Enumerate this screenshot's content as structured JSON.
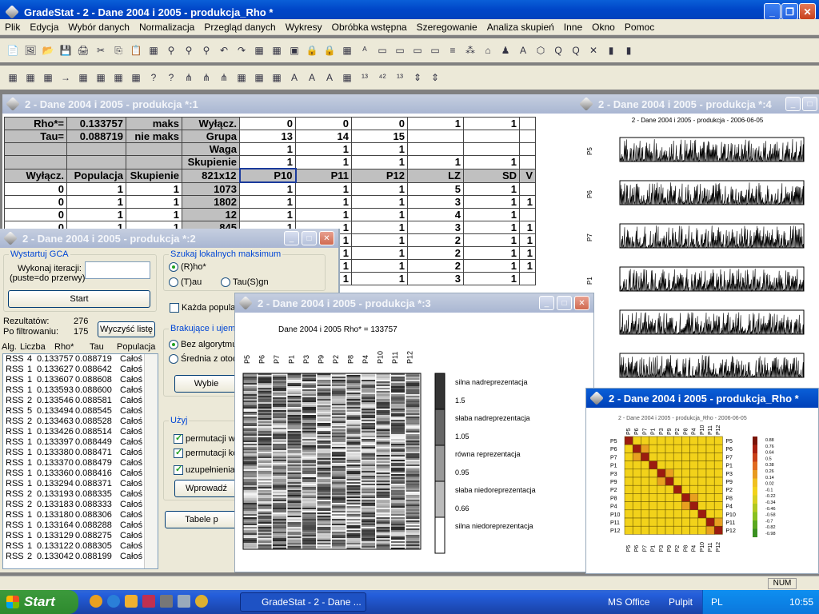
{
  "app": {
    "title": "GradeStat - 2 - Dane 2004 i 2005 - produkcja_Rho *"
  },
  "menu": [
    "Plik",
    "Edycja",
    "Wybór danych",
    "Normalizacja",
    "Przegląd danych",
    "Wykresy",
    "Obróbka wstępna",
    "Szeregowanie",
    "Analiza skupień",
    "Inne",
    "Okno",
    "Pomoc"
  ],
  "win1": {
    "title": "2 - Dane 2004 i 2005 - produkcja *:1",
    "header_rows": [
      [
        "Rho*=",
        "0.133757",
        "maks",
        "Wyłącz.",
        "0",
        "0",
        "0",
        "1",
        "1",
        ""
      ],
      [
        "Tau=",
        "0.088719",
        "nie maks",
        "Grupa",
        "13",
        "14",
        "15",
        "",
        "",
        ""
      ],
      [
        "",
        "",
        "",
        "Waga",
        "1",
        "1",
        "1",
        "",
        "",
        ""
      ],
      [
        "",
        "",
        "",
        "Skupienie",
        "1",
        "1",
        "1",
        "1",
        "1",
        ""
      ],
      [
        "Wyłącz.",
        "Populacja",
        "Skupienie",
        "821x12",
        "P10",
        "P11",
        "P12",
        "LZ",
        "SD",
        "V"
      ],
      [
        "0",
        "1",
        "1",
        "1073",
        "1",
        "1",
        "1",
        "5",
        "1",
        ""
      ],
      [
        "0",
        "1",
        "1",
        "1802",
        "1",
        "1",
        "1",
        "3",
        "1",
        "1"
      ],
      [
        "0",
        "1",
        "1",
        "12",
        "1",
        "1",
        "1",
        "4",
        "1",
        ""
      ],
      [
        "0",
        "1",
        "1",
        "845",
        "1",
        "1",
        "1",
        "3",
        "1",
        "1"
      ]
    ],
    "extra_rows": [
      [
        "1",
        "1",
        "1",
        "2",
        "1",
        "1"
      ],
      [
        "1",
        "1",
        "1",
        "2",
        "1",
        "1"
      ],
      [
        "1",
        "1",
        "1",
        "2",
        "1",
        "1"
      ],
      [
        "1",
        "1",
        "1",
        "3",
        "1",
        ""
      ]
    ]
  },
  "win2": {
    "title": "2 - Dane 2004 i 2005 - produkcja *:2",
    "gca_group": "Wystartuj GCA",
    "iter_label": "Wykonaj iteracji:",
    "iter_hint": "(puste=do przerwy)",
    "start_btn": "Start",
    "local_group": "Szukaj lokalnych maksimum",
    "opt_rho": "(R)ho*",
    "opt_tau": "(T)au",
    "opt_taus": "Tau(S)gn",
    "each_pop": "Każda popula",
    "results_label": "Rezultatów:",
    "results_value": "276",
    "filtered_label": "Po filtrowaniu:",
    "filtered_value": "175",
    "clear_btn": "Wyczyść listę",
    "missing_group": "Brakujące i ujem",
    "opt_noalg": "Bez algorytmu",
    "opt_avg": "Średnia z otoc",
    "select_btn": "Wybie",
    "use_group": "Użyj",
    "use1": "permutacji w",
    "use2": "permutacji ko",
    "use3": "uzupełnienia",
    "enter_btn": "Wprowadź",
    "tables_btn": "Tabele p",
    "list_headers": [
      "Alg.",
      "Liczba",
      "Rho*",
      "Tau",
      "Populacja"
    ],
    "list_rows": [
      [
        "RSS",
        "4",
        "0.133757",
        "0.088719",
        "Całoś"
      ],
      [
        "RSS",
        "1",
        "0.133627",
        "0.088642",
        "Całoś"
      ],
      [
        "RSS",
        "1",
        "0.133607",
        "0.088608",
        "Całoś"
      ],
      [
        "RSS",
        "1",
        "0.133593",
        "0.088600",
        "Całoś"
      ],
      [
        "RSS",
        "2",
        "0.133546",
        "0.088581",
        "Całoś"
      ],
      [
        "RSS",
        "5",
        "0.133494",
        "0.088545",
        "Całoś"
      ],
      [
        "RSS",
        "2",
        "0.133463",
        "0.088528",
        "Całoś"
      ],
      [
        "RSS",
        "1",
        "0.133426",
        "0.088514",
        "Całoś"
      ],
      [
        "RSS",
        "1",
        "0.133397",
        "0.088449",
        "Całoś"
      ],
      [
        "RSS",
        "1",
        "0.133380",
        "0.088471",
        "Całoś"
      ],
      [
        "RSS",
        "1",
        "0.133370",
        "0.088479",
        "Całoś"
      ],
      [
        "RSS",
        "1",
        "0.133360",
        "0.088416",
        "Całoś"
      ],
      [
        "RSS",
        "1",
        "0.133294",
        "0.088371",
        "Całoś"
      ],
      [
        "RSS",
        "2",
        "0.133193",
        "0.088335",
        "Całoś"
      ],
      [
        "RSS",
        "2",
        "0.133183",
        "0.088333",
        "Całoś"
      ],
      [
        "RSS",
        "1",
        "0.133180",
        "0.088306",
        "Całoś"
      ],
      [
        "RSS",
        "1",
        "0.133164",
        "0.088288",
        "Całoś"
      ],
      [
        "RSS",
        "1",
        "0.133129",
        "0.088275",
        "Całoś"
      ],
      [
        "RSS",
        "1",
        "0.133122",
        "0.088305",
        "Całoś"
      ],
      [
        "RSS",
        "2",
        "0.133042",
        "0.088199",
        "Całoś"
      ]
    ]
  },
  "win3": {
    "title": "2 - Dane 2004 i 2005 - produkcja *:3",
    "caption": "Dane 2004 i 2005 Rho* = 133757",
    "columns": [
      "P5",
      "P6",
      "P7",
      "P1",
      "P3",
      "P9",
      "P2",
      "P8",
      "P4",
      "P10",
      "P11",
      "P12"
    ],
    "legend": [
      "silna nadreprezentacja",
      "1.5",
      "słaba nadreprezentacja",
      "1.05",
      "równa reprezentacja",
      "0.95",
      "słaba niedoreprezentacja",
      "0.66",
      "silna niedoreprezentacja"
    ]
  },
  "win4": {
    "title": "2 - Dane 2004 i 2005 - produkcja *:4",
    "chart_title": "2 - Dane 2004 i 2005 - produkcja - 2006-06-05",
    "series": [
      "P5",
      "P6",
      "P7",
      "P1",
      "",
      ""
    ]
  },
  "win5": {
    "title": "2 - Dane 2004 i 2005 - produkcja_Rho *",
    "chart_title": "2 - Dane 2004 i 2005 - produkcja_Rho - 2006-06-05",
    "labels": [
      "P5",
      "P6",
      "P7",
      "P1",
      "P3",
      "P9",
      "P2",
      "P8",
      "P4",
      "P10",
      "P11",
      "P12"
    ],
    "scale": [
      "0.88",
      "0.76",
      "0.64",
      "0.5",
      "0.38",
      "0.26",
      "0.14",
      "0.02",
      "-0.1",
      "-0.22",
      "-0.34",
      "-0.46",
      "-0.58",
      "-0.7",
      "-0.82",
      "-0.98"
    ]
  },
  "status": {
    "num": "NUM"
  },
  "taskbar": {
    "start": "Start",
    "task": "GradeStat - 2 - Dane ...",
    "office": "MS Office",
    "pulpit": "Pulpit",
    "lang": "PL",
    "clock": "10:55"
  },
  "colors": {
    "xp_blue": "#0046c8",
    "panel": "#ece9d8",
    "heat_diag": "#9b1c10",
    "heat_base": "#f2d21a"
  }
}
